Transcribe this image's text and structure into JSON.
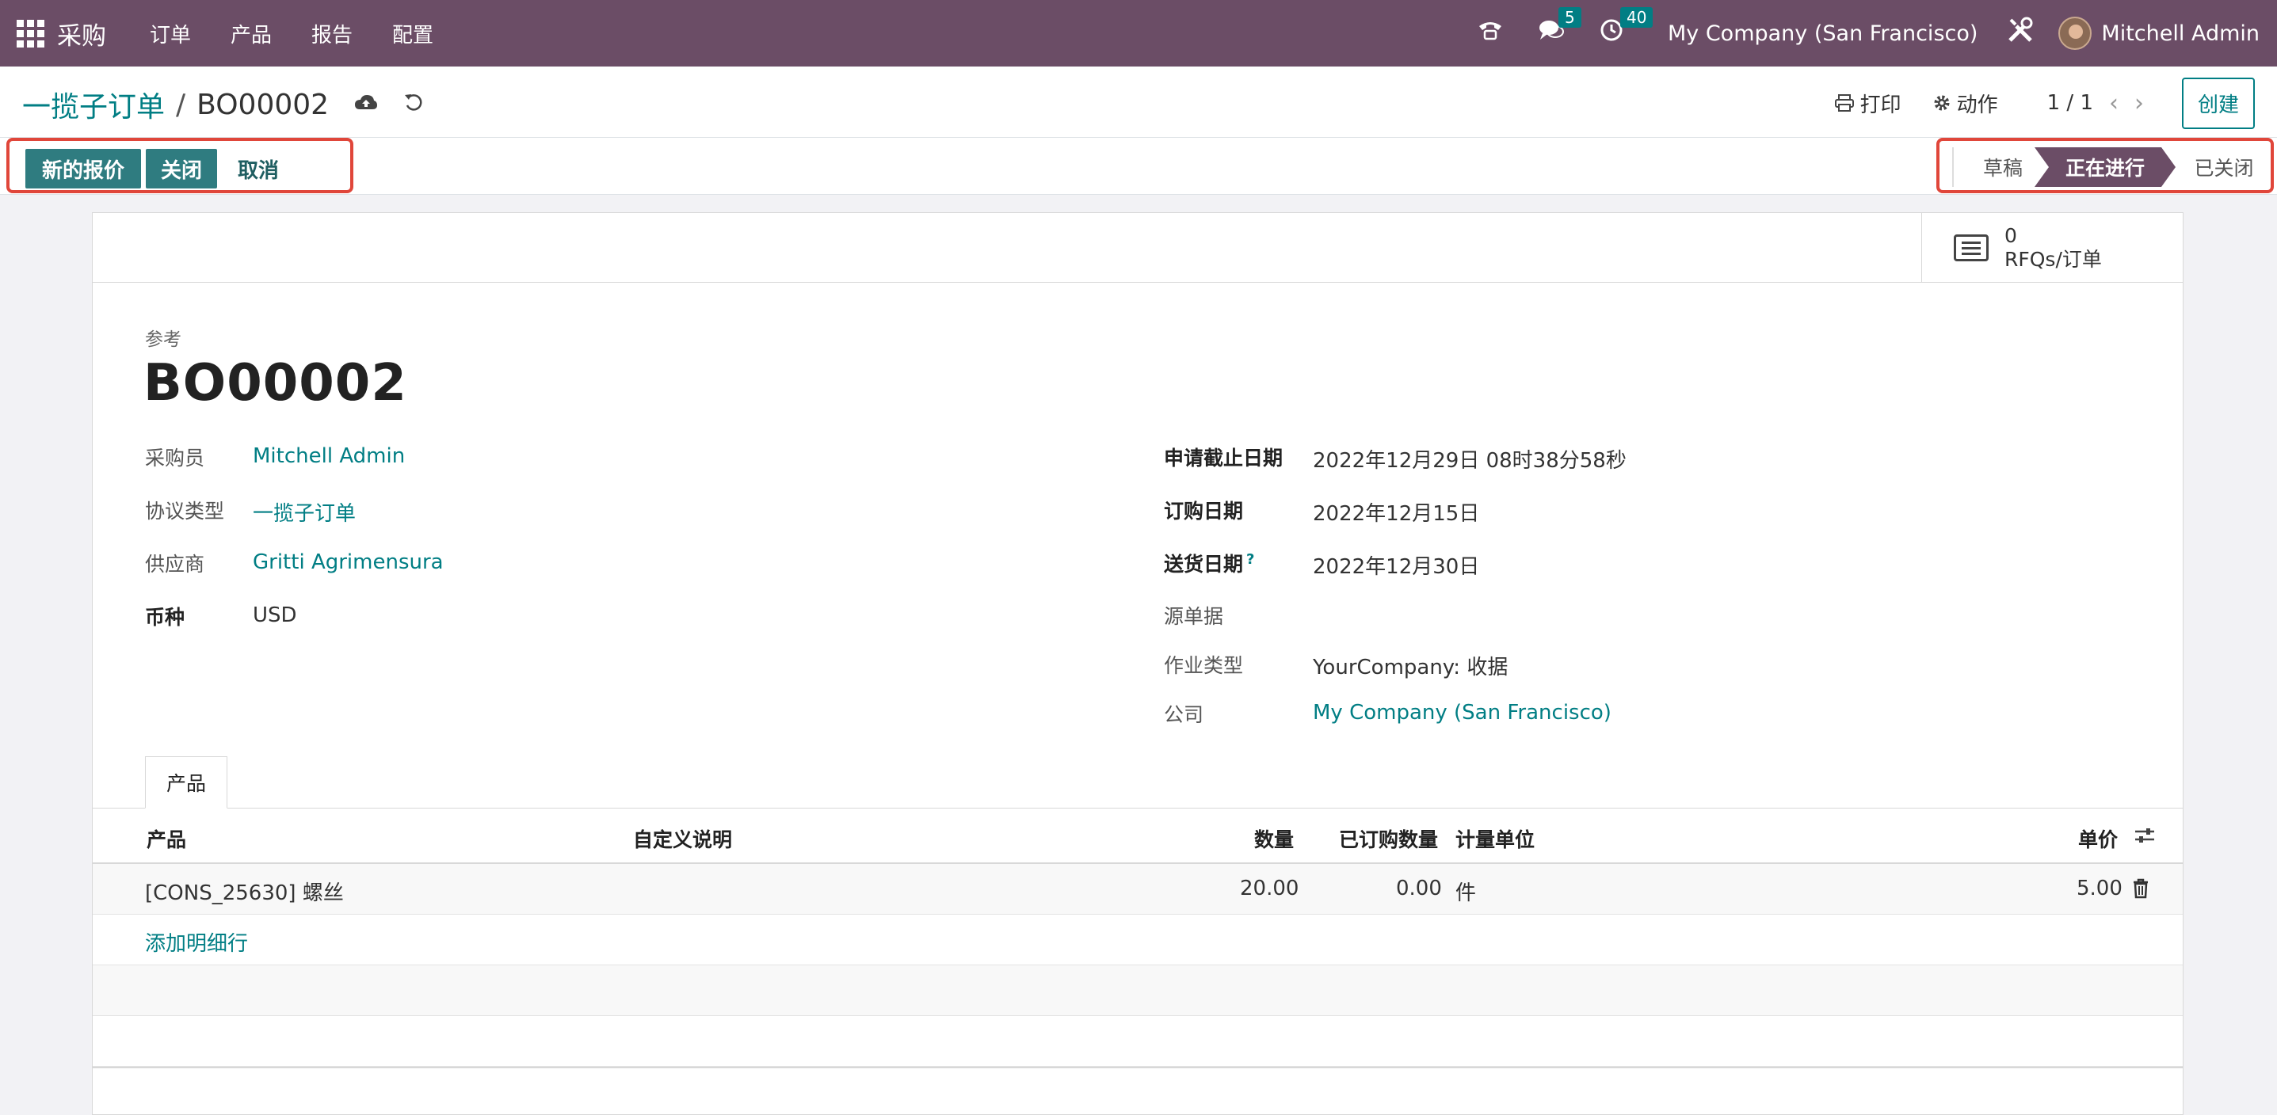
{
  "navbar": {
    "app_name": "采购",
    "menus": [
      "订单",
      "产品",
      "报告",
      "配置"
    ],
    "messages_count": "5",
    "activities_count": "40",
    "company": "My Company (San Francisco)",
    "user": "Mitchell Admin"
  },
  "control": {
    "breadcrumb_parent": "一揽子订单",
    "breadcrumb_sep": "/",
    "breadcrumb_current": "BO00002",
    "print_label": "打印",
    "action_label": "动作",
    "pager": "1 / 1",
    "create_label": "创建"
  },
  "statusbar": {
    "buttons": {
      "new_quote": "新的报价",
      "close": "关闭",
      "cancel": "取消"
    },
    "stages": [
      "草稿",
      "正在进行",
      "已关闭"
    ],
    "active_stage": "正在进行"
  },
  "smart_button": {
    "count": "0",
    "label": "RFQs/订单"
  },
  "form": {
    "ref_label": "参考",
    "ref_name": "BO00002",
    "left": [
      {
        "label": "采购员",
        "value": "Mitchell Admin"
      },
      {
        "label": "协议类型",
        "value": "一揽子订单"
      },
      {
        "label": "供应商",
        "value": "Gritti Agrimensura"
      },
      {
        "label": "币种",
        "value": "USD"
      }
    ],
    "right": [
      {
        "label": "申请截止日期",
        "value": "2022年12月29日 08时38分58秒"
      },
      {
        "label": "订购日期",
        "value": "2022年12月15日"
      },
      {
        "label": "送货日期",
        "value": "2022年12月30日"
      },
      {
        "label": "源单据",
        "value": ""
      },
      {
        "label": "作业类型",
        "value": "YourCompany: 收据"
      },
      {
        "label": "公司",
        "value": "My Company (San Francisco)"
      }
    ],
    "help_mark": "?"
  },
  "tab": {
    "label": "产品"
  },
  "table": {
    "headers": {
      "product": "产品",
      "description": "自定义说明",
      "qty": "数量",
      "ordered_qty": "已订购数量",
      "uom": "计量单位",
      "price": "单价"
    },
    "rows": [
      {
        "product": "[CONS_25630] 螺丝",
        "description": "",
        "qty": "20.00",
        "ordered_qty": "0.00",
        "uom": "件",
        "price": "5.00"
      }
    ],
    "add_line": "添加明细行"
  },
  "colors": {
    "brand": "#6b4d66",
    "accent": "#017e84",
    "primary_button": "#2f7c80",
    "highlight_box": "#e0463a"
  },
  "icons": [
    "apps-grid-icon",
    "phone-icon",
    "chat-icon",
    "clock-icon",
    "tools-icon",
    "cloud-upload-icon",
    "undo-icon",
    "print-icon",
    "gear-icon",
    "chevron-left-icon",
    "chevron-right-icon",
    "list-icon",
    "sliders-icon",
    "trash-icon"
  ]
}
